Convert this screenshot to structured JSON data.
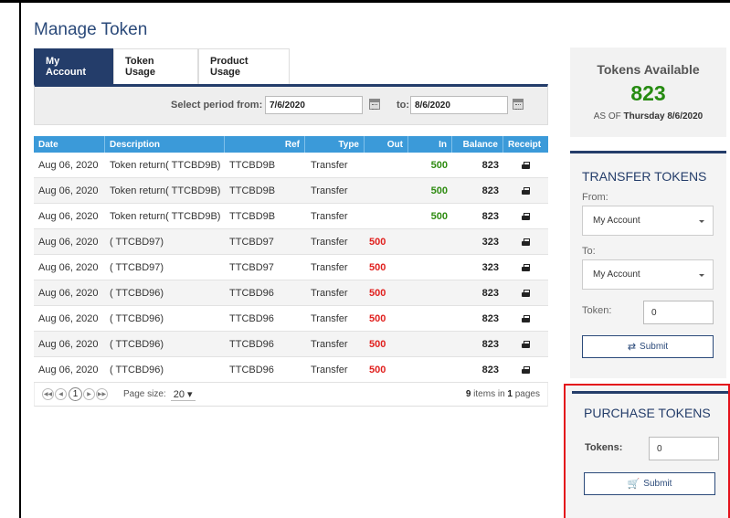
{
  "page": {
    "title": "Manage Token"
  },
  "tabs": [
    {
      "label": "My Account",
      "active": true
    },
    {
      "label": "Token Usage",
      "active": false
    },
    {
      "label": "Product Usage",
      "active": false
    }
  ],
  "period": {
    "from_label": "Select period from:",
    "from_value": "7/6/2020",
    "to_label": "to:",
    "to_value": "8/6/2020"
  },
  "table": {
    "columns": [
      "Date",
      "Description",
      "Ref",
      "Type",
      "Out",
      "In",
      "Balance",
      "Receipt"
    ],
    "rows": [
      {
        "date": "Aug 06, 2020",
        "description": "Token return( TTCBD9B)",
        "ref": "TTCBD9B",
        "type": "Transfer",
        "out": "",
        "in": "500",
        "balance": "823"
      },
      {
        "date": "Aug 06, 2020",
        "description": "Token return( TTCBD9B)",
        "ref": "TTCBD9B",
        "type": "Transfer",
        "out": "",
        "in": "500",
        "balance": "823"
      },
      {
        "date": "Aug 06, 2020",
        "description": "Token return( TTCBD9B)",
        "ref": "TTCBD9B",
        "type": "Transfer",
        "out": "",
        "in": "500",
        "balance": "823"
      },
      {
        "date": "Aug 06, 2020",
        "description": "( TTCBD97)",
        "ref": "TTCBD97",
        "type": "Transfer",
        "out": "500",
        "in": "",
        "balance": "323"
      },
      {
        "date": "Aug 06, 2020",
        "description": "( TTCBD97)",
        "ref": "TTCBD97",
        "type": "Transfer",
        "out": "500",
        "in": "",
        "balance": "323"
      },
      {
        "date": "Aug 06, 2020",
        "description": "( TTCBD96)",
        "ref": "TTCBD96",
        "type": "Transfer",
        "out": "500",
        "in": "",
        "balance": "823"
      },
      {
        "date": "Aug 06, 2020",
        "description": "( TTCBD96)",
        "ref": "TTCBD96",
        "type": "Transfer",
        "out": "500",
        "in": "",
        "balance": "823"
      },
      {
        "date": "Aug 06, 2020",
        "description": "( TTCBD96)",
        "ref": "TTCBD96",
        "type": "Transfer",
        "out": "500",
        "in": "",
        "balance": "823"
      },
      {
        "date": "Aug 06, 2020",
        "description": "( TTCBD96)",
        "ref": "TTCBD96",
        "type": "Transfer",
        "out": "500",
        "in": "",
        "balance": "823"
      }
    ]
  },
  "pager": {
    "current_page": "1",
    "page_size_label": "Page size:",
    "page_size": "20",
    "items_count": "9",
    "items_label_1": "items in",
    "pages_count": "1",
    "items_label_2": "pages"
  },
  "tokens_available": {
    "title": "Tokens Available",
    "value": "823",
    "as_of_label": "AS OF",
    "as_of_date": "Thursday 8/6/2020"
  },
  "transfer": {
    "title": "TRANSFER TOKENS",
    "from_label": "From:",
    "from_value": "My Account",
    "to_label": "To:",
    "to_value": "My Account",
    "token_label": "Token:",
    "token_value": "0",
    "submit_label": "Submit"
  },
  "purchase": {
    "title": "PURCHASE TOKENS",
    "tokens_label": "Tokens:",
    "tokens_value": "0",
    "submit_label": "Submit"
  },
  "colors": {
    "navy": "#243d6a",
    "header_blue": "#3b9ad9",
    "in_green": "#2e8b10",
    "out_red": "#e0201e",
    "highlight_red": "#e4121b"
  }
}
